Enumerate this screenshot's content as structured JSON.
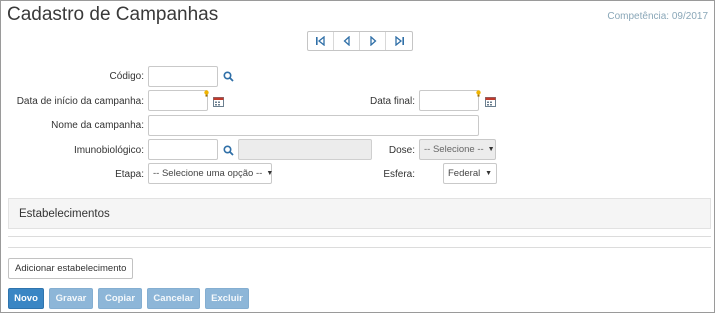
{
  "header": {
    "title": "Cadastro de Campanhas",
    "competencia": "Competência: 09/2017"
  },
  "nav": {
    "first_icon": "first-page-icon",
    "prev_icon": "previous-icon",
    "next_icon": "next-icon",
    "last_icon": "last-page-icon"
  },
  "form": {
    "codigo_label": "Código:",
    "codigo_value": "",
    "data_inicio_label": "Data de início da campanha:",
    "data_inicio_value": "",
    "data_final_label": "Data final:",
    "data_final_value": "",
    "nome_label": "Nome da campanha:",
    "nome_value": "",
    "imuno_label": "Imunobiológico:",
    "imuno_value": "",
    "imuno_desc_value": "",
    "dose_label": "Dose:",
    "dose_selected": "-- Selecione --",
    "etapa_label": "Etapa:",
    "etapa_selected": "-- Selecione uma opção --",
    "esfera_label": "Esfera:",
    "esfera_selected": "Federal"
  },
  "section": {
    "title": "Estabelecimentos"
  },
  "actions": {
    "add_estab": "Adicionar estabelecimento",
    "novo": "Novo",
    "gravar": "Gravar",
    "copiar": "Copiar",
    "cancelar": "Cancelar",
    "excluir": "Excluir"
  },
  "colors": {
    "primary": "#3a86c4",
    "disabled_button": "#8db6d8",
    "competencia_text": "#8aa7b8"
  }
}
